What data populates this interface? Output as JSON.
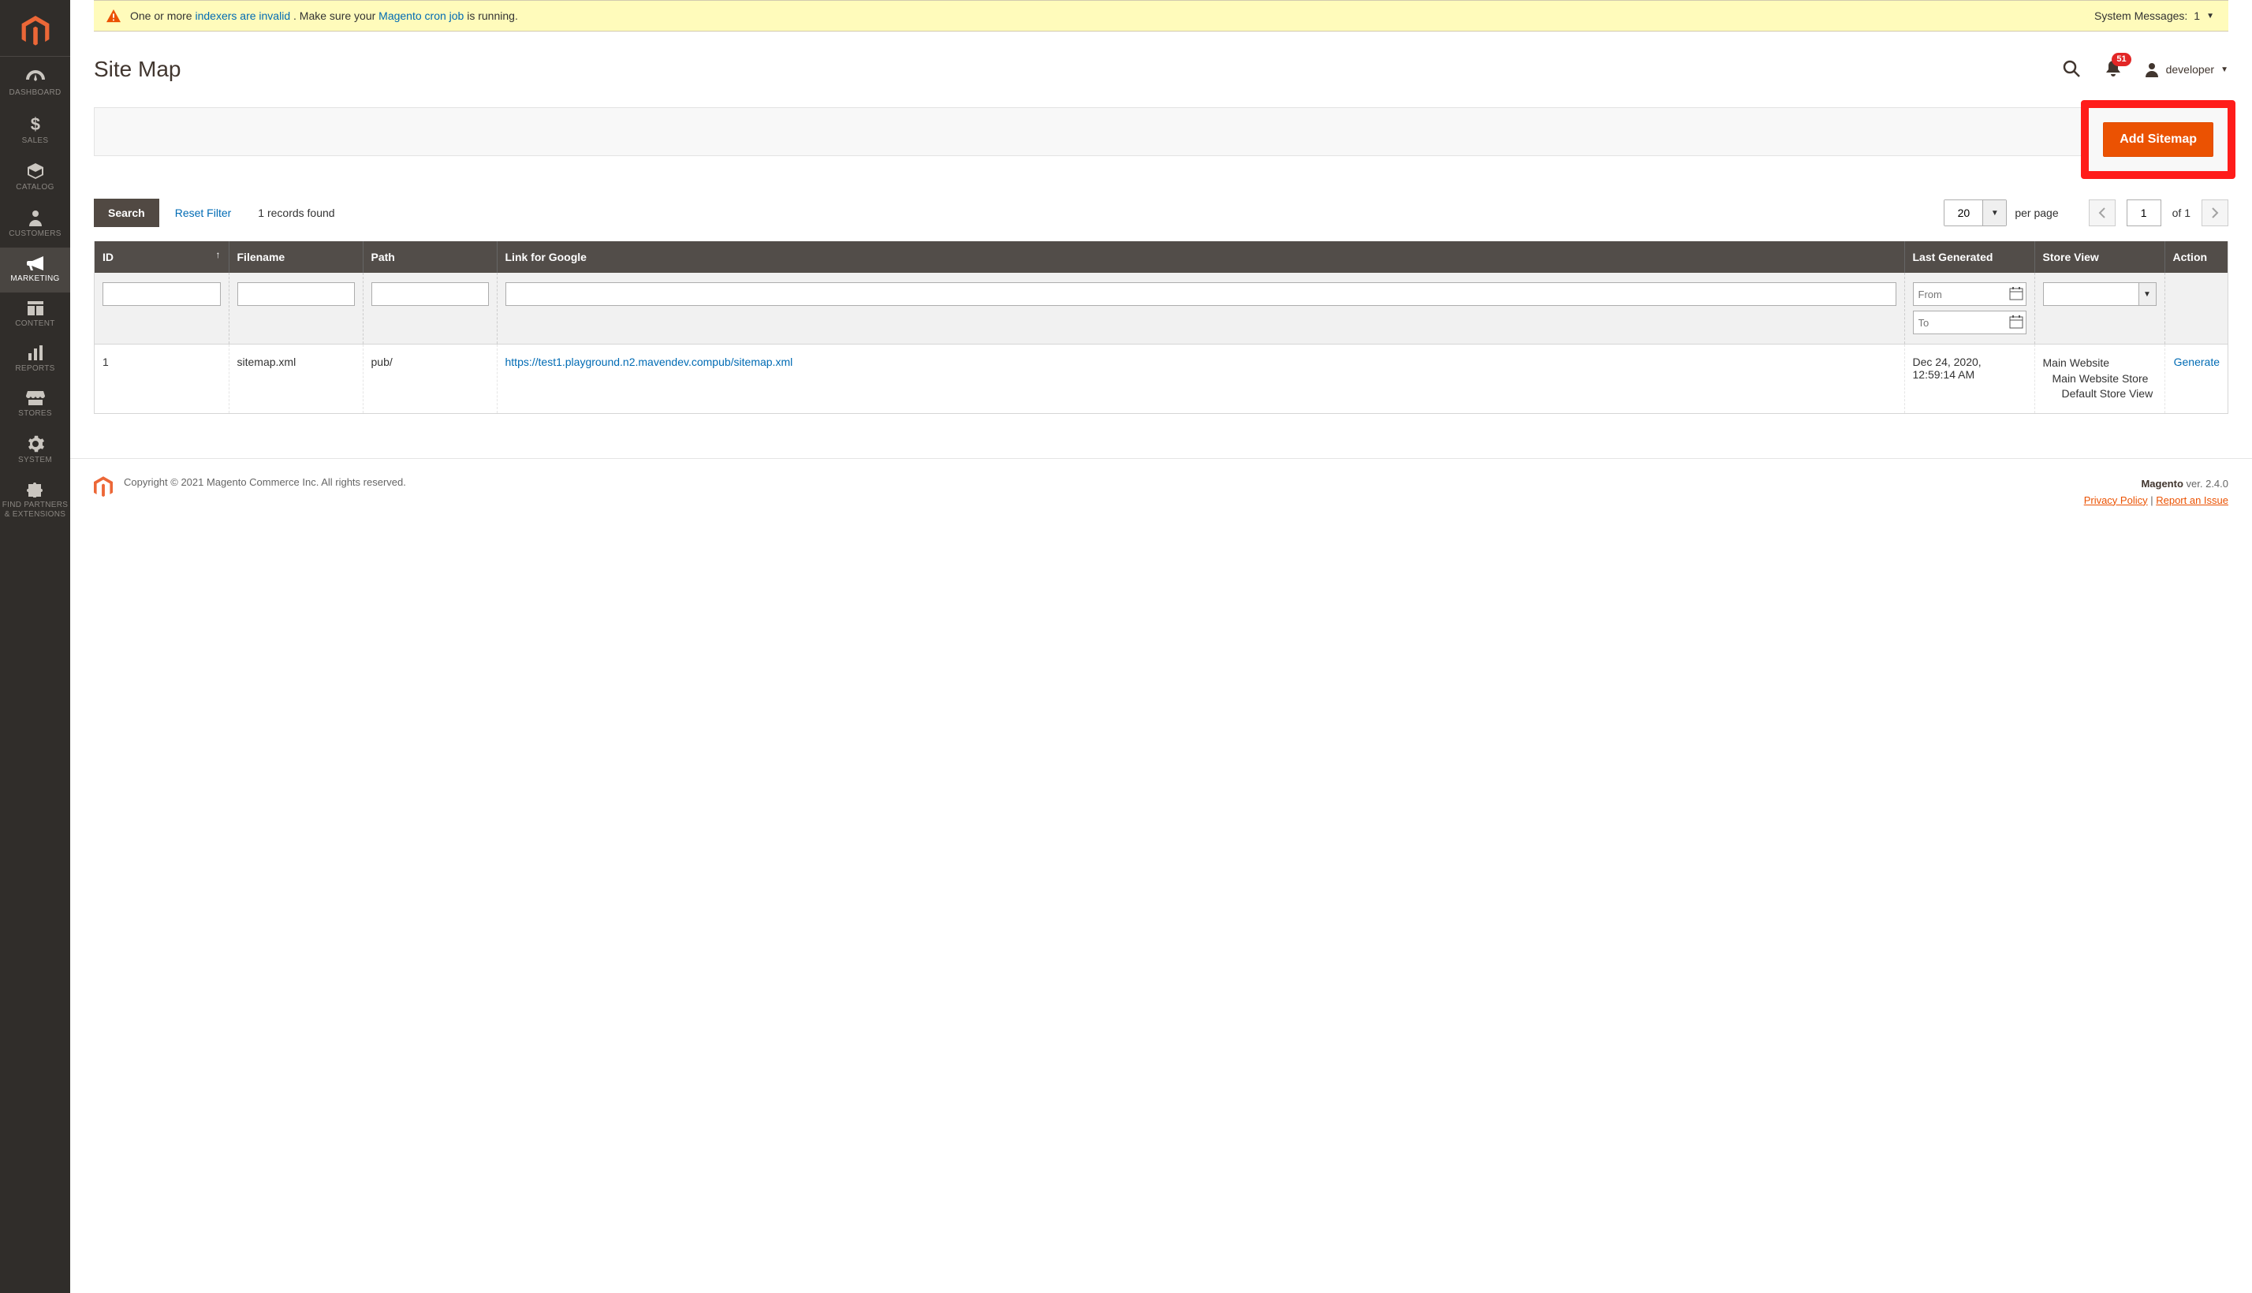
{
  "sidebar": {
    "items": [
      {
        "label": "DASHBOARD"
      },
      {
        "label": "SALES"
      },
      {
        "label": "CATALOG"
      },
      {
        "label": "CUSTOMERS"
      },
      {
        "label": "MARKETING"
      },
      {
        "label": "CONTENT"
      },
      {
        "label": "REPORTS"
      },
      {
        "label": "STORES"
      },
      {
        "label": "SYSTEM"
      },
      {
        "label_line1": "FIND PARTNERS",
        "label_line2": "& EXTENSIONS"
      }
    ],
    "active_index": 4
  },
  "system_message": {
    "text_before": "One or more ",
    "link1": "indexers are invalid",
    "text_mid": ". Make sure your ",
    "link2": "Magento cron job",
    "text_after": " is running.",
    "counter_label": "System Messages:",
    "counter_value": "1"
  },
  "page": {
    "title": "Site Map",
    "notif_count": "51",
    "user_name": "developer"
  },
  "actions": {
    "add_sitemap": "Add Sitemap"
  },
  "grid_controls": {
    "search": "Search",
    "reset": "Reset Filter",
    "records": "1 records found",
    "per_page_value": "20",
    "per_page_label": "per page",
    "page_value": "1",
    "of_pages": "of 1"
  },
  "grid": {
    "columns": {
      "id": "ID",
      "filename": "Filename",
      "path": "Path",
      "link": "Link for Google",
      "generated": "Last Generated",
      "store": "Store View",
      "action": "Action"
    },
    "filters": {
      "date_from_placeholder": "From",
      "date_to_placeholder": "To"
    },
    "rows": [
      {
        "id": "1",
        "filename": "sitemap.xml",
        "path": "pub/",
        "link": "https://test1.playground.n2.mavendev.compub/sitemap.xml",
        "generated": "Dec 24, 2020, 12:59:14 AM",
        "store_l1": "Main Website",
        "store_l2": "Main Website Store",
        "store_l3": "Default Store View",
        "action": "Generate"
      }
    ]
  },
  "footer": {
    "copyright": "Copyright © 2021 Magento Commerce Inc. All rights reserved.",
    "version_label": "Magento",
    "version_value": " ver. 2.4.0",
    "privacy": "Privacy Policy",
    "sep": " | ",
    "report": "Report an Issue"
  }
}
